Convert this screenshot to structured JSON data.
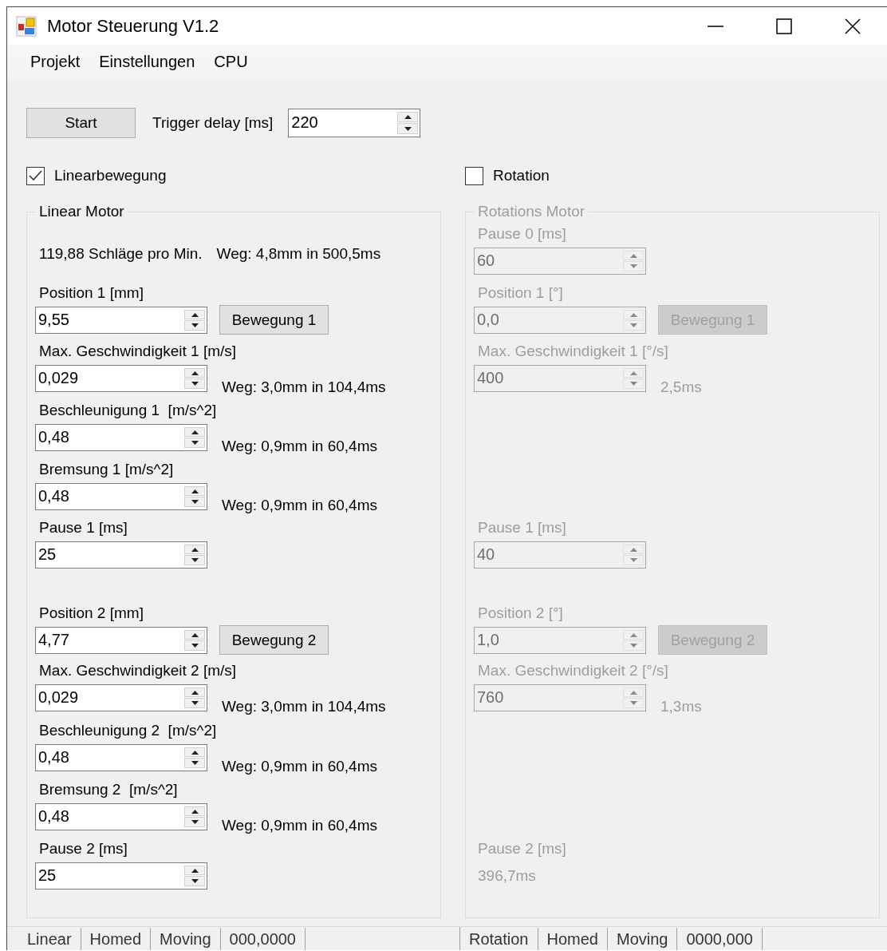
{
  "window": {
    "title": "Motor Steuerung V1.2"
  },
  "menu": [
    {
      "label": "Projekt"
    },
    {
      "label": "Einstellungen"
    },
    {
      "label": "CPU"
    }
  ],
  "toolbar": {
    "start_button": "Start",
    "trigger_delay": {
      "label": "Trigger delay [ms]",
      "value": "220"
    }
  },
  "sections": [
    {
      "checkbox": {
        "label": "Linearbewegung",
        "checked": true
      },
      "group": {
        "title": "Linear Motor",
        "disabled": false,
        "items": [
          {
            "kind": "info",
            "texts": [
              "119,88 Schläge pro Min.",
              "Weg: 4,8mm in 500,5ms"
            ]
          },
          {
            "kind": "field",
            "label": "Position 1 [mm]",
            "value": "9,55",
            "button": "Bewegung 1"
          },
          {
            "kind": "field",
            "label": "Max. Geschwindigkeit 1 [m/s]",
            "value": "0,029",
            "note": "Weg: 3,0mm in 104,4ms"
          },
          {
            "kind": "field",
            "label": "Beschleunigung 1  [m/s^2]",
            "value": "0,48",
            "note": "Weg: 0,9mm in 60,4ms"
          },
          {
            "kind": "field",
            "label": "Bremsung 1 [m/s^2]",
            "value": "0,48",
            "note": "Weg: 0,9mm in 60,4ms"
          },
          {
            "kind": "field",
            "label": "Pause 1 [ms]",
            "value": "25"
          },
          {
            "kind": "field",
            "label": "Position 2 [mm]",
            "value": "4,77",
            "button": "Bewegung 2"
          },
          {
            "kind": "field",
            "label": "Max. Geschwindigkeit 2 [m/s]",
            "value": "0,029",
            "note": "Weg: 3,0mm in 104,4ms"
          },
          {
            "kind": "field",
            "label": "Beschleunigung 2  [m/s^2]",
            "value": "0,48",
            "note": "Weg: 0,9mm in 60,4ms"
          },
          {
            "kind": "field",
            "label": "Bremsung 2  [m/s^2]",
            "value": "0,48",
            "note": "Weg: 0,9mm in 60,4ms"
          },
          {
            "kind": "field",
            "label": "Pause 2 [ms]",
            "value": "25"
          }
        ]
      }
    },
    {
      "checkbox": {
        "label": "Rotation",
        "checked": false
      },
      "group": {
        "title": "Rotations Motor",
        "disabled": true,
        "items": [
          {
            "kind": "field",
            "label": "Pause 0 [ms]",
            "value": "60"
          },
          {
            "kind": "field",
            "label": "Position 1 [°]",
            "value": "0,0",
            "button": "Bewegung 1"
          },
          {
            "kind": "field",
            "label": "Max. Geschwindigkeit 1 [°/s]",
            "value": "400",
            "note": "2,5ms"
          },
          {
            "kind": "field",
            "label": "Pause 1 [ms]",
            "value": "40"
          },
          {
            "kind": "field",
            "label": "Position 2 [°]",
            "value": "1,0",
            "button": "Bewegung 2"
          },
          {
            "kind": "field",
            "label": "Max. Geschwindigkeit 2 [°/s]",
            "value": "760",
            "note": "1,3ms"
          },
          {
            "kind": "readout",
            "label": "Pause 2 [ms]",
            "text": "396,7ms"
          }
        ]
      }
    }
  ],
  "status_bar": [
    {
      "items": [
        "Linear",
        "Homed",
        "Moving",
        "000,0000"
      ]
    },
    {
      "items": [
        "Rotation",
        "Homed",
        "Moving",
        "0000,000"
      ]
    }
  ]
}
